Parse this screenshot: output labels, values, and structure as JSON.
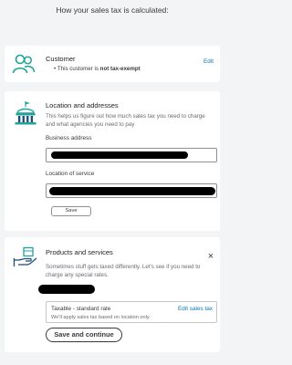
{
  "page": {
    "title": "How your sales tax is calculated:"
  },
  "customer": {
    "heading": "Customer",
    "bullet_prefix": "This customer is",
    "bullet_bold": "not tax-exempt",
    "edit_label": "Edit",
    "icon": "people-icon"
  },
  "location": {
    "heading": "Location and addresses",
    "description": "This helps us figure out how much sales tax you need to charge and what agencies you need to pay",
    "business_address_label": "Business address",
    "service_location_label": "Location of service",
    "save_label": "Save",
    "icon": "government-building-icon"
  },
  "products": {
    "heading": "Products and services",
    "description": "Sometimes stuff gets taxed differently. Let's see if you need to charge any special rates.",
    "rate_title": "Taxable - standard rate",
    "rate_note": "We'll apply sales tax based on location only.",
    "edit_rate_label": "Edit sales tax",
    "primary_button_label": "Save and continue",
    "close_icon_glyph": "×",
    "icon": "package-hand-icon"
  },
  "colors": {
    "accent_teal": "#1fa39a",
    "link_blue": "#0a76b7",
    "text": "#393a3d"
  }
}
